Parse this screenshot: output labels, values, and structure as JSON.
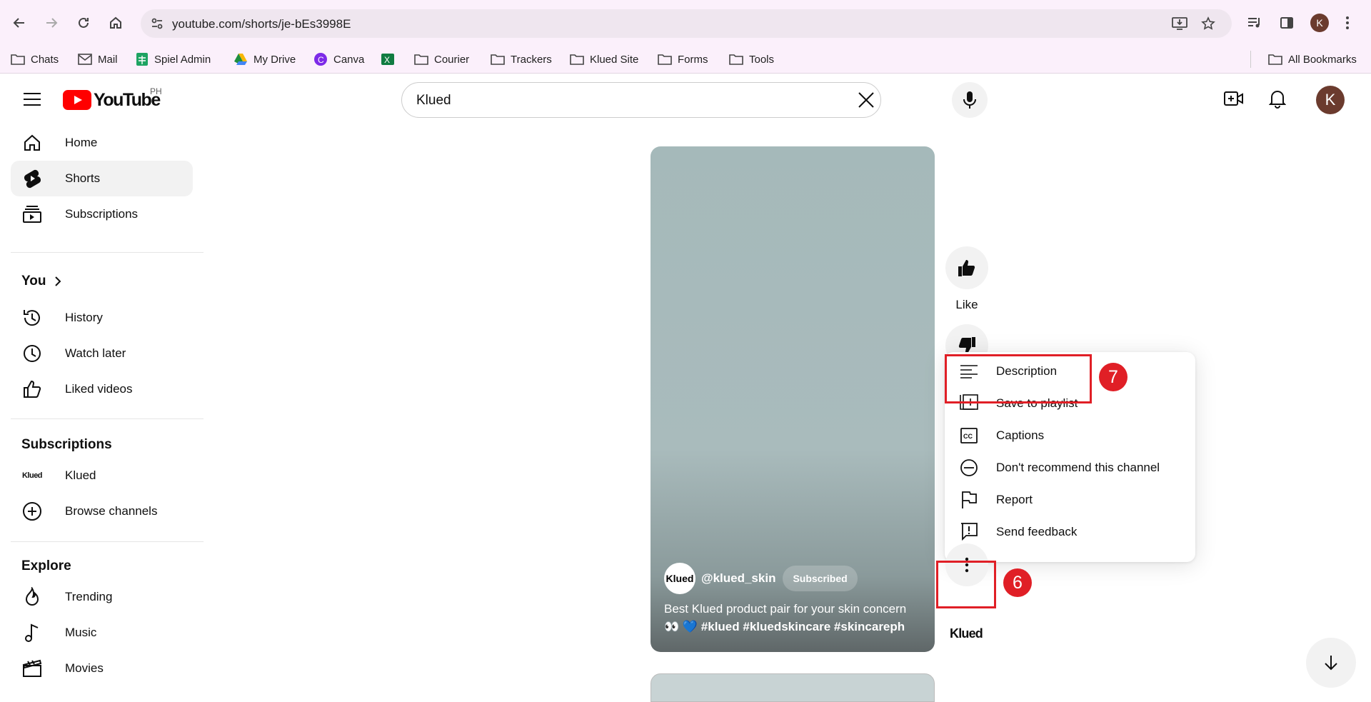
{
  "browser": {
    "url": "youtube.com/shorts/je-bEs3998E",
    "avatar_letter": "K",
    "bookmarks": [
      {
        "label": "Chats",
        "icon": "folder-icon"
      },
      {
        "label": "Mail",
        "icon": "mail-icon"
      },
      {
        "label": "Spiel Admin",
        "icon": "sheets-icon"
      },
      {
        "label": "My Drive",
        "icon": "drive-icon"
      },
      {
        "label": "Canva",
        "icon": "canva-icon"
      },
      {
        "label": "",
        "icon": "excel-icon"
      },
      {
        "label": "Courier",
        "icon": "folder-icon"
      },
      {
        "label": "Trackers",
        "icon": "folder-icon"
      },
      {
        "label": "Klued Site",
        "icon": "folder-icon"
      },
      {
        "label": "Forms",
        "icon": "folder-icon"
      },
      {
        "label": "Tools",
        "icon": "folder-icon"
      }
    ],
    "all_bookmarks": "All Bookmarks"
  },
  "youtube": {
    "logo_text": "YouTube",
    "region": "PH",
    "search_value": "Klued",
    "avatar_letter": "K"
  },
  "sidebar": {
    "main": [
      {
        "label": "Home",
        "icon": "home-icon"
      },
      {
        "label": "Shorts",
        "icon": "shorts-icon"
      },
      {
        "label": "Subscriptions",
        "icon": "subscriptions-icon"
      }
    ],
    "you_heading": "You",
    "you": [
      {
        "label": "History",
        "icon": "history-icon"
      },
      {
        "label": "Watch later",
        "icon": "watch-later-icon"
      },
      {
        "label": "Liked videos",
        "icon": "liked-icon"
      }
    ],
    "subscriptions_heading": "Subscriptions",
    "subscriptions": [
      {
        "label": "Klued",
        "icon": "klued-logo"
      },
      {
        "label": "Browse channels",
        "icon": "add-circle-icon"
      }
    ],
    "explore_heading": "Explore",
    "explore": [
      {
        "label": "Trending",
        "icon": "trending-icon"
      },
      {
        "label": "Music",
        "icon": "music-icon"
      },
      {
        "label": "Movies",
        "icon": "movies-icon"
      }
    ]
  },
  "short": {
    "channel_avatar_text": "Klued",
    "channel": "@klued_skin",
    "subscribe_label": "Subscribed",
    "caption_line1": "Best Klued product pair for your skin concern",
    "caption_line2": "👀 💙 #klued #kluedskincare #skincareph"
  },
  "actions": {
    "like_label": "Like",
    "channel_logo_text": "Klued"
  },
  "menu": {
    "items": [
      {
        "label": "Description",
        "icon": "description-icon"
      },
      {
        "label": "Save to playlist",
        "icon": "playlist-add-icon"
      },
      {
        "label": "Captions",
        "icon": "captions-icon"
      },
      {
        "label": "Don't recommend this channel",
        "icon": "block-icon"
      },
      {
        "label": "Report",
        "icon": "flag-icon"
      },
      {
        "label": "Send feedback",
        "icon": "feedback-icon"
      }
    ]
  },
  "annotations": {
    "step_menu": "7",
    "step_more": "6"
  },
  "colors": {
    "highlight": "#e01f26",
    "youtube_red": "#ff0000"
  }
}
